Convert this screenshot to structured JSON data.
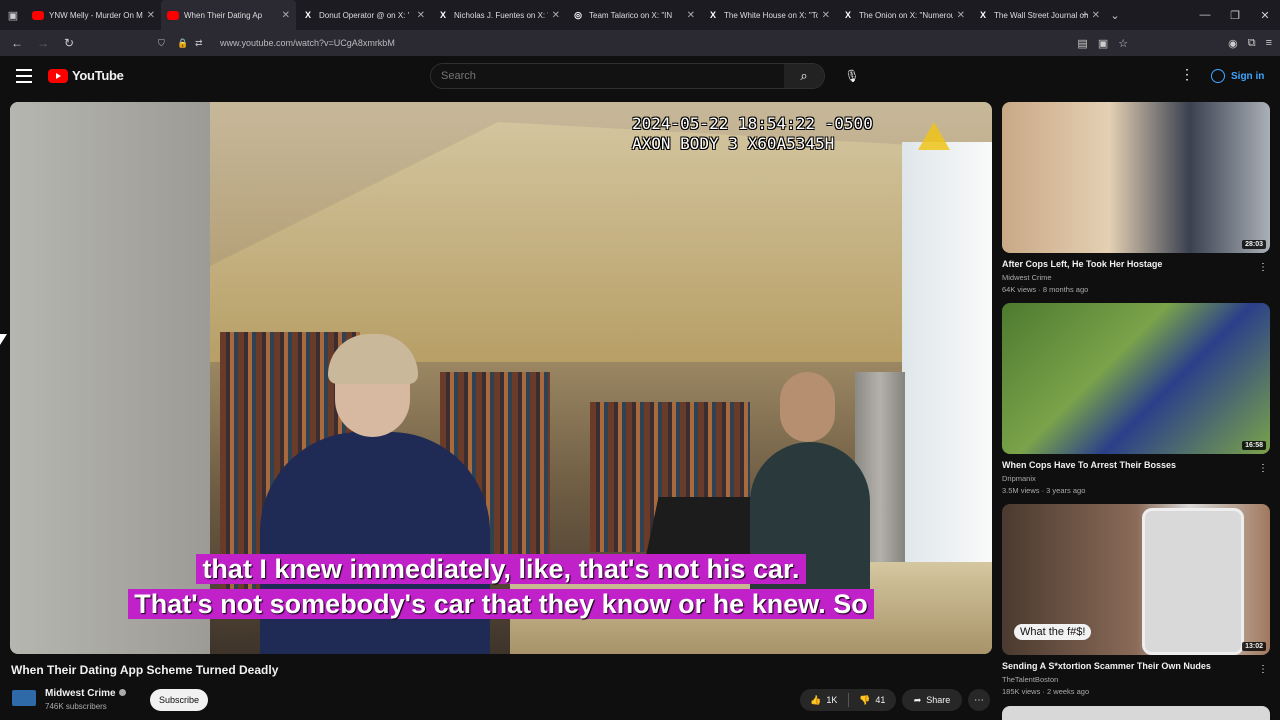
{
  "browser": {
    "tabs": [
      {
        "title": "YNW Melly - Murder On M",
        "icon": "youtube",
        "active": false
      },
      {
        "title": "When Their Dating Ap",
        "icon": "youtube",
        "active": true
      },
      {
        "title": "Donut Operator @ on X: '",
        "icon": "x",
        "active": false
      },
      {
        "title": "Nicholas J. Fuentes on X: \"I",
        "icon": "x",
        "active": false
      },
      {
        "title": "Team Talarico on X: \"IN",
        "icon": "x",
        "active": false
      },
      {
        "title": "The White House on X: \"To",
        "icon": "x",
        "active": false
      },
      {
        "title": "The Onion on X: \"Numerou",
        "icon": "x",
        "active": false
      },
      {
        "title": "The Wall Street Journal on",
        "icon": "x",
        "active": false
      }
    ],
    "url": "www.youtube.com/watch?v=UCgA8xmrkbM"
  },
  "youtube": {
    "logo_text": "YouTube",
    "search_placeholder": "Search",
    "signin_label": "Sign in"
  },
  "video": {
    "osd_line1": "2024-05-22 18:54:22 -0500",
    "osd_line2": "AXON BODY 3 X60A5345H",
    "caption_line1": "that I knew immediately, like, that's not his car.",
    "caption_line2": "That's not somebody's car that they know or he knew. So",
    "title": "When Their Dating App Scheme Turned Deadly",
    "channel": "Midwest Crime",
    "subscribers": "746K subscribers",
    "subscribe_label": "Subscribe",
    "likes": "1K",
    "dislikes": "41",
    "share_label": "Share"
  },
  "recommendations": [
    {
      "title": "After Cops Left, He Took Her Hostage",
      "channel": "Midwest Crime",
      "meta": "64K views · 8 months ago",
      "duration": "28:03"
    },
    {
      "title": "When Cops Have To Arrest Their Bosses",
      "channel": "Dripmanix",
      "meta": "3.5M views · 3 years ago",
      "duration": "16:58"
    },
    {
      "title": "Sending A S*xtortion Scammer Their Own Nudes",
      "channel": "TheTalentBoston",
      "meta": "185K views · 2 weeks ago",
      "duration": "13:02",
      "badge": "What the f#$!"
    }
  ],
  "colors": {
    "accent": "#ff0000",
    "caption_bg": "#c021c9",
    "link": "#3ea6ff"
  }
}
